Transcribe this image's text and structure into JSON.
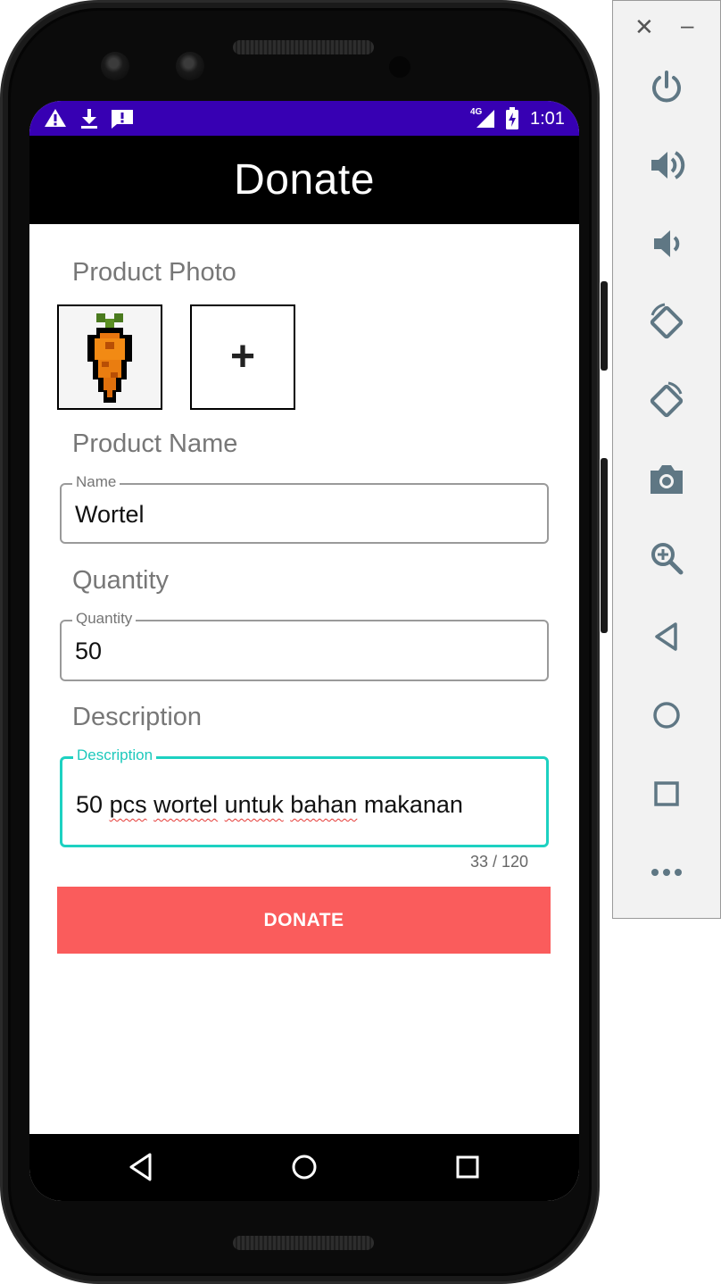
{
  "status_bar": {
    "time": "1:01",
    "network": "4G"
  },
  "app_bar": {
    "title": "Donate"
  },
  "form": {
    "photo_section_label": "Product Photo",
    "name_section_label": "Product Name",
    "name_field": {
      "label": "Name",
      "value": "Wortel"
    },
    "quantity_section_label": "Quantity",
    "quantity_field": {
      "label": "Quantity",
      "value": "50"
    },
    "description_section_label": "Description",
    "description_field": {
      "label": "Description",
      "words": [
        "50",
        "pcs",
        "wortel",
        "untuk",
        "bahan",
        "makanan"
      ],
      "counter": "33 / 120"
    },
    "add_photo_symbol": "+",
    "submit_label": "DONATE"
  },
  "colors": {
    "status_bar": "#3700b3",
    "app_bar": "#000000",
    "focus_accent": "#1dd1c1",
    "button": "#fa5c5c"
  },
  "emulator_panel": {
    "close_symbol": "✕",
    "minimize_symbol": "–",
    "icons": [
      "power-icon",
      "volume-up-icon",
      "volume-down-icon",
      "rotate-left-icon",
      "rotate-right-icon",
      "camera-icon",
      "zoom-icon",
      "back-icon",
      "home-icon",
      "overview-icon",
      "more-icon"
    ]
  }
}
